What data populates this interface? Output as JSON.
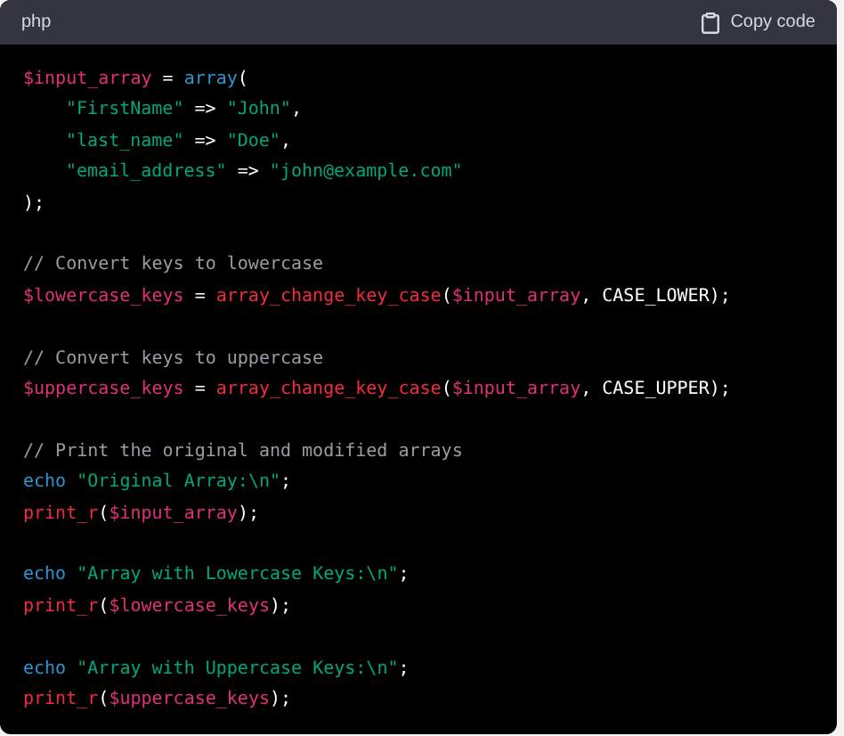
{
  "header": {
    "language": "php",
    "copy_button": "Copy code"
  },
  "code_lines": [
    {
      "kind": "code",
      "indented": false,
      "tokens": [
        {
          "kind": "variable",
          "text": "$input_array"
        },
        {
          "kind": "plain",
          "text": " = "
        },
        {
          "kind": "keyword",
          "text": "array"
        },
        {
          "kind": "plain",
          "text": "("
        }
      ]
    },
    {
      "kind": "code",
      "indented": true,
      "tokens": [
        {
          "kind": "string",
          "text": "\"FirstName\""
        },
        {
          "kind": "plain",
          "text": " => "
        },
        {
          "kind": "string",
          "text": "\"John\""
        },
        {
          "kind": "plain",
          "text": ","
        }
      ]
    },
    {
      "kind": "code",
      "indented": true,
      "tokens": [
        {
          "kind": "string",
          "text": "\"last_name\""
        },
        {
          "kind": "plain",
          "text": " => "
        },
        {
          "kind": "string",
          "text": "\"Doe\""
        },
        {
          "kind": "plain",
          "text": ","
        }
      ]
    },
    {
      "kind": "code",
      "indented": true,
      "tokens": [
        {
          "kind": "string",
          "text": "\"email_address\""
        },
        {
          "kind": "plain",
          "text": " => "
        },
        {
          "kind": "string",
          "text": "\"john@example.com\""
        }
      ]
    },
    {
      "kind": "code",
      "indented": false,
      "tokens": [
        {
          "kind": "plain",
          "text": ");"
        }
      ]
    },
    {
      "kind": "blank"
    },
    {
      "kind": "code",
      "indented": false,
      "tokens": [
        {
          "kind": "comment",
          "text": "// Convert keys to lowercase"
        }
      ]
    },
    {
      "kind": "code",
      "indented": false,
      "tokens": [
        {
          "kind": "variable",
          "text": "$lowercase_keys"
        },
        {
          "kind": "plain",
          "text": " = "
        },
        {
          "kind": "function",
          "text": "array_change_key_case"
        },
        {
          "kind": "plain",
          "text": "("
        },
        {
          "kind": "variable",
          "text": "$input_array"
        },
        {
          "kind": "plain",
          "text": ", CASE_LOWER);"
        }
      ]
    },
    {
      "kind": "blank"
    },
    {
      "kind": "code",
      "indented": false,
      "tokens": [
        {
          "kind": "comment",
          "text": "// Convert keys to uppercase"
        }
      ]
    },
    {
      "kind": "code",
      "indented": false,
      "tokens": [
        {
          "kind": "variable",
          "text": "$uppercase_keys"
        },
        {
          "kind": "plain",
          "text": " = "
        },
        {
          "kind": "function",
          "text": "array_change_key_case"
        },
        {
          "kind": "plain",
          "text": "("
        },
        {
          "kind": "variable",
          "text": "$input_array"
        },
        {
          "kind": "plain",
          "text": ", CASE_UPPER);"
        }
      ]
    },
    {
      "kind": "blank"
    },
    {
      "kind": "code",
      "indented": false,
      "tokens": [
        {
          "kind": "comment",
          "text": "// Print the original and modified arrays"
        }
      ]
    },
    {
      "kind": "code",
      "indented": false,
      "tokens": [
        {
          "kind": "keyword",
          "text": "echo"
        },
        {
          "kind": "string",
          "text": " \"Original Array:\\n\""
        },
        {
          "kind": "plain",
          "text": ";"
        }
      ]
    },
    {
      "kind": "code",
      "indented": false,
      "tokens": [
        {
          "kind": "function",
          "text": "print_r"
        },
        {
          "kind": "plain",
          "text": "("
        },
        {
          "kind": "variable",
          "text": "$input_array"
        },
        {
          "kind": "plain",
          "text": ");"
        }
      ]
    },
    {
      "kind": "blank"
    },
    {
      "kind": "code",
      "indented": false,
      "tokens": [
        {
          "kind": "keyword",
          "text": "echo"
        },
        {
          "kind": "string",
          "text": " \"Array with Lowercase Keys:\\n\""
        },
        {
          "kind": "plain",
          "text": ";"
        }
      ]
    },
    {
      "kind": "code",
      "indented": false,
      "tokens": [
        {
          "kind": "function",
          "text": "print_r"
        },
        {
          "kind": "plain",
          "text": "("
        },
        {
          "kind": "variable",
          "text": "$lowercase_keys"
        },
        {
          "kind": "plain",
          "text": ");"
        }
      ]
    },
    {
      "kind": "blank"
    },
    {
      "kind": "code",
      "indented": false,
      "tokens": [
        {
          "kind": "keyword",
          "text": "echo"
        },
        {
          "kind": "string",
          "text": " \"Array with Uppercase Keys:\\n\""
        },
        {
          "kind": "plain",
          "text": ";"
        }
      ]
    },
    {
      "kind": "code",
      "indented": false,
      "tokens": [
        {
          "kind": "function",
          "text": "print_r"
        },
        {
          "kind": "plain",
          "text": "("
        },
        {
          "kind": "variable",
          "text": "$uppercase_keys"
        },
        {
          "kind": "plain",
          "text": ");"
        }
      ]
    }
  ]
}
